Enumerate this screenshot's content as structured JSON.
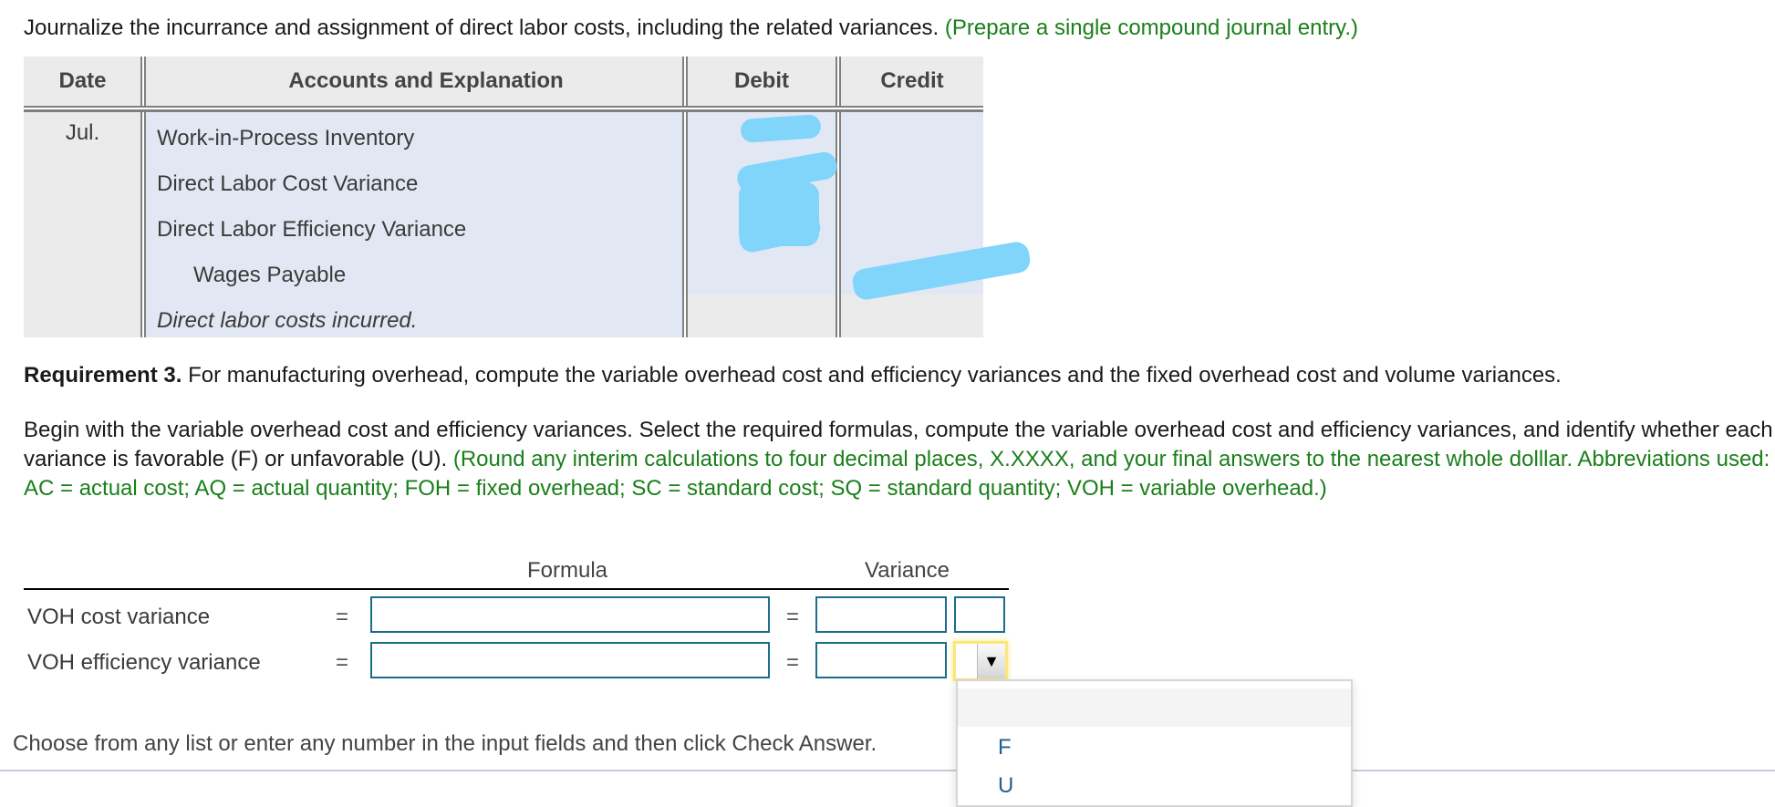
{
  "instruction": {
    "main": "Journalize the incurrance and assignment of direct labor costs, including the related variances.",
    "note": "(Prepare a single compound journal entry.)"
  },
  "journal": {
    "headers": {
      "date": "Date",
      "accounts": "Accounts and Explanation",
      "debit": "Debit",
      "credit": "Credit"
    },
    "date": "Jul.",
    "rows": [
      {
        "account": "Work-in-Process Inventory",
        "debit": "",
        "credit": "",
        "indent": false
      },
      {
        "account": "Direct Labor Cost Variance",
        "debit": "",
        "credit": "",
        "indent": false
      },
      {
        "account": "Direct Labor Efficiency Variance",
        "debit": "",
        "credit": "",
        "indent": false
      },
      {
        "account": "Wages Payable",
        "debit": "",
        "credit": "",
        "indent": true
      }
    ],
    "explanation": "Direct labor costs incurred."
  },
  "requirement": {
    "label": "Requirement 3.",
    "text": "For manufacturing overhead, compute the variable overhead cost and efficiency variances and the fixed overhead cost and volume variances."
  },
  "paragraph": {
    "text": "Begin with the variable overhead cost and efficiency variances. Select the required formulas, compute the variable overhead cost and efficiency variances, and identify whether each variance is favorable (F) or unfavorable (U).",
    "note": "(Round any interim calculations to four decimal places, X.XXXX, and your final answers to the nearest whole dolllar. Abbreviations used: AC = actual cost; AQ = actual quantity; FOH = fixed overhead; SC = standard cost; SQ = standard quantity; VOH = variable overhead.)"
  },
  "variance_table": {
    "headers": {
      "formula": "Formula",
      "variance": "Variance"
    },
    "equals": "=",
    "rows": [
      {
        "label": "VOH cost variance",
        "formula": "",
        "variance": "",
        "fu": ""
      },
      {
        "label": "VOH efficiency variance",
        "formula": "",
        "variance": "",
        "fu": ""
      }
    ]
  },
  "dropdown": {
    "arrow": "▼",
    "options": [
      "",
      "F",
      "U"
    ]
  },
  "footer": {
    "text": "Choose from any list or enter any number in the input fields and then click Check Answer."
  },
  "colors": {
    "green_note": "#1a7f1a",
    "input_border": "#1a6e8a",
    "focus_highlight": "#fbe77a",
    "entry_bg": "#e2e8f3",
    "option_text": "#1f5f93"
  }
}
